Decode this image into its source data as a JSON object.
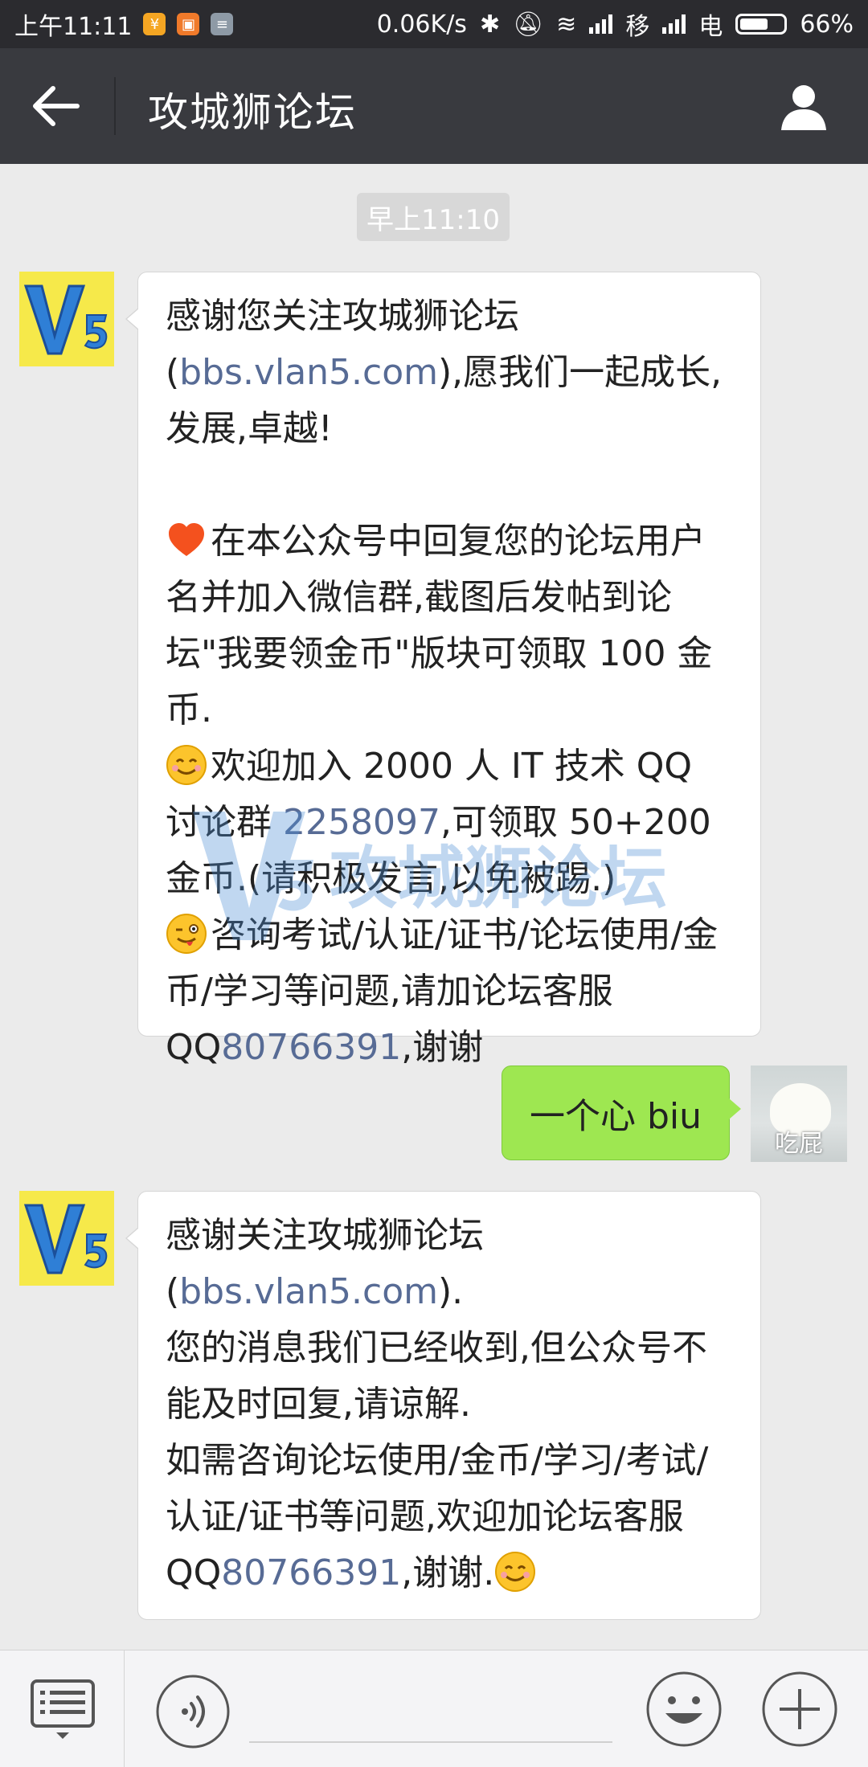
{
  "status_bar": {
    "time": "上午11:11",
    "net_speed": "0.06K/s",
    "carrier1": "移",
    "carrier2": "电",
    "battery": "66%",
    "battery_level": 0.66
  },
  "header": {
    "title": "攻城狮论坛"
  },
  "chat": {
    "timestamp": "早上11:10",
    "msg1": {
      "p1_a": "感谢您关注攻城狮论坛(",
      "p1_link": "bbs.vlan5.com",
      "p1_b": "),愿我们一起成长,发展,卓越!",
      "p2": "在本公众号中回复您的论坛用户名并加入微信群,截图后发帖到论坛\"我要领金币\"版块可领取 100 金币.",
      "p3_a": "欢迎加入 2000 人 IT 技术 QQ 讨论群 ",
      "p3_link": "2258097",
      "p3_b": ",可领取 50+200 金币.(请积极发言,以免被踢.)",
      "p4_a": "咨询考试/认证/证书/论坛使用/金币/学习等问题,请加论坛客服QQ",
      "p4_link": "80766391",
      "p4_b": ",谢谢"
    },
    "msg2": {
      "text": "一个心 biu",
      "avatar_caption": "吃屁"
    },
    "msg3": {
      "p1_a": "感谢关注攻城狮论坛(",
      "p1_link": "bbs.vlan5.com",
      "p1_b": ").",
      "p2": "您的消息我们已经收到,但公众号不能及时回复,请谅解.",
      "p3_a": "如需咨询论坛使用/金币/学习/考试/认证/证书等问题,欢迎加论坛客服QQ",
      "p3_link": "80766391",
      "p3_b": ",谢谢."
    },
    "watermark_text": "攻城狮论坛"
  },
  "colors": {
    "link": "#576b95",
    "bubble_green": "#9ee751",
    "header_bg": "#393a3f"
  }
}
